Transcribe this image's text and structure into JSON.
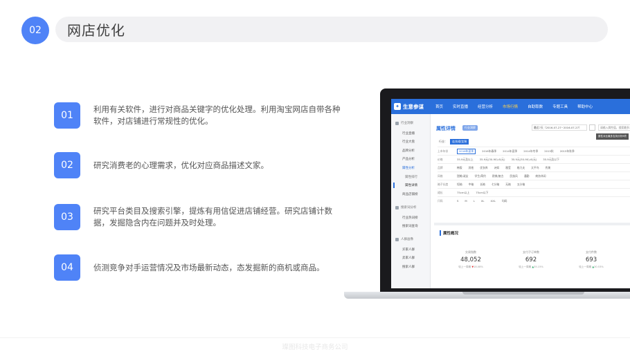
{
  "header": {
    "number": "02",
    "title": "网店优化"
  },
  "items": [
    {
      "number": "01",
      "text": "利用有关软件，进行对商品关键字的优化处理。利用淘宝网店自带各种软件，对店铺进行常规性的优化。"
    },
    {
      "number": "02",
      "text": "研究消费老的心理需求，优化对应商品描述文家。"
    },
    {
      "number": "03",
      "text": "研究平台类目及搜索引擎，提炼有用信促进店铺经营。研究店铺计数据，发掘隐含内在问题并及时处理。"
    },
    {
      "number": "04",
      "text": "侦测竞争对手运营情况及市场最新动态，态发掘新的商机或商品。"
    }
  ],
  "app": {
    "logo": "生意参谋",
    "nav": [
      "首页",
      "实时直播",
      "经营分析",
      "市场行情",
      "自助取数",
      "专题工具",
      "帮助中心"
    ],
    "nav_active_index": 3,
    "sidebar": {
      "groups": [
        "行业洞察",
        "搜索词分析",
        "人群画像"
      ],
      "items": [
        "行业直播",
        "行业大盘",
        "品牌分析",
        "产品分析",
        "属性分析",
        "属性排行",
        "属性详情",
        "商品店铺榜",
        "行业热词榜",
        "搜索词查询",
        "买家人群",
        "卖家人群",
        "搜索人群"
      ]
    },
    "content_title": "属性详情",
    "title_tag": "行业洞察",
    "date_range": "最近7天（2016-07-27~2016-07-27）",
    "search_placeholder": "请输入属性值，搜索最多7个",
    "tooltip": "属性对比最多支持分析9项",
    "industry_label": "行业：",
    "industry_tag": "连衣裙/女装",
    "filters": [
      {
        "label": "上市年份",
        "options": [
          "2016年夏季",
          "2016年春季",
          "2014年夏季",
          "2014年冬季",
          "2015秋",
          "2015年秋季",
          "2016年春季"
        ]
      },
      {
        "label": "价格",
        "options": [
          "35.9元及以上",
          "35.9元(30-90)-6(元)",
          "35.9元(30-90)-6(元)",
          "35.9元及以下"
        ]
      },
      {
        "label": "品牌",
        "options": [
          "韩版",
          "其他",
          "优衣库",
          "诗如",
          "雅莹",
          "格力夫",
          "太平鸟",
          "秀美",
          "大众"
        ]
      },
      {
        "label": "风格",
        "options": [
          "甜美/淑女",
          "学生/简约",
          "欧美/复古",
          "民族风",
          "通勤",
          "商务休闲"
        ]
      },
      {
        "label": "袖子长度",
        "options": [
          "短袖",
          "中袖",
          "长袖",
          "七分袖",
          "无袖",
          "五分袖"
        ]
      },
      {
        "label": "裙长",
        "options": [
          "75cm以上",
          "75cm以下"
        ]
      },
      {
        "label": "尺码",
        "options": [
          "S",
          "M",
          "L",
          "XL",
          "XXL",
          "均码"
        ]
      }
    ],
    "overview_title": "属性概况",
    "metrics": [
      {
        "label": "交易指数",
        "value": "48,052",
        "compare": "较上一周期",
        "change": "18.08%",
        "direction": "down"
      },
      {
        "label": "支付子订单数",
        "value": "692",
        "compare": "较上一周期",
        "change": "35.15%",
        "direction": "up"
      },
      {
        "label": "支付件数",
        "value": "693",
        "compare": "较上一周期",
        "change": "30.53%",
        "direction": "up"
      }
    ]
  },
  "footer": {
    "text": "璨图科技电子商务公司"
  },
  "colors": {
    "accent": "#4f83f7",
    "app_nav": "#2a6fdb",
    "active_nav": "#ffd24a"
  }
}
